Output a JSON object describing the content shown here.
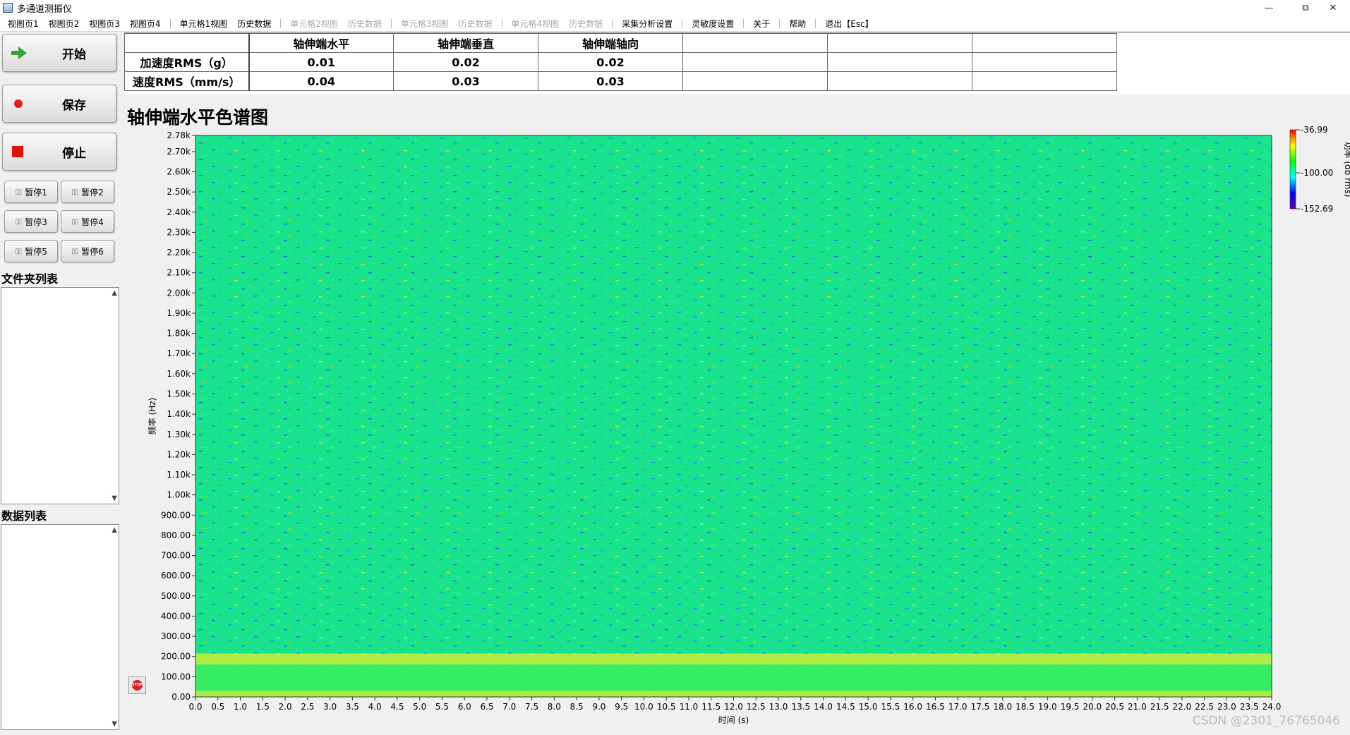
{
  "window": {
    "title": "多通道测振仪",
    "controls": [
      "—",
      "⧉",
      "✕"
    ]
  },
  "menu": [
    {
      "label": "视图页1",
      "enabled": true
    },
    {
      "label": "视图页2",
      "enabled": true
    },
    {
      "label": "视图页3",
      "enabled": true
    },
    {
      "label": "视图页4",
      "enabled": true
    },
    {
      "sep": true
    },
    {
      "label": "单元格1视图",
      "enabled": true
    },
    {
      "label": "历史数据",
      "enabled": true
    },
    {
      "sep": true
    },
    {
      "label": "单元格2视图",
      "enabled": false
    },
    {
      "label": "历史数据",
      "enabled": false
    },
    {
      "sep": true
    },
    {
      "label": "单元格3视图",
      "enabled": false
    },
    {
      "label": "历史数据",
      "enabled": false
    },
    {
      "sep": true
    },
    {
      "label": "单元格4视图",
      "enabled": false
    },
    {
      "label": "历史数据",
      "enabled": false
    },
    {
      "sep": true
    },
    {
      "label": "采集分析设置",
      "enabled": true
    },
    {
      "sep": true
    },
    {
      "label": "灵敏度设置",
      "enabled": true
    },
    {
      "sep": true
    },
    {
      "label": "关于",
      "enabled": true
    },
    {
      "sep": true
    },
    {
      "label": "帮助",
      "enabled": true
    },
    {
      "sep": true
    },
    {
      "label": "退出【Esc】",
      "enabled": true
    }
  ],
  "controls": {
    "start_label": "开始",
    "save_label": "保存",
    "stop_label": "停止",
    "pause_buttons": [
      "暂停1",
      "暂停2",
      "暂停3",
      "暂停4",
      "暂停5",
      "暂停6"
    ]
  },
  "folder_list": {
    "label": "文件夹列表",
    "items": []
  },
  "data_list": {
    "label": "数据列表",
    "items": []
  },
  "rms_table": {
    "headers": [
      "",
      "轴伸端水平",
      "轴伸端垂直",
      "轴伸端轴向",
      "",
      "",
      ""
    ],
    "rows": [
      {
        "label": "加速度RMS（g）",
        "values": [
          "0.01",
          "0.02",
          "0.02",
          "",
          "",
          ""
        ]
      },
      {
        "label": "速度RMS（mm/s）",
        "values": [
          "0.04",
          "0.03",
          "0.03",
          "",
          "",
          ""
        ]
      }
    ]
  },
  "chart_data": {
    "type": "heatmap",
    "title": "轴伸端水平色谱图",
    "xlabel": "时间 (s)",
    "ylabel": "频率 (Hz)",
    "xlim": [
      0,
      24
    ],
    "ylim": [
      0,
      2780
    ],
    "x_ticks": [
      "0.0",
      "0.5",
      "1.0",
      "1.5",
      "2.0",
      "2.5",
      "3.0",
      "3.5",
      "4.0",
      "4.5",
      "5.0",
      "5.5",
      "6.0",
      "6.5",
      "7.0",
      "7.5",
      "8.0",
      "8.5",
      "9.0",
      "9.5",
      "10.0",
      "10.5",
      "11.0",
      "11.5",
      "12.0",
      "12.5",
      "13.0",
      "13.5",
      "14.0",
      "14.5",
      "15.0",
      "15.5",
      "16.0",
      "16.5",
      "17.0",
      "17.5",
      "18.0",
      "18.5",
      "19.0",
      "19.5",
      "20.0",
      "20.5",
      "21.0",
      "21.5",
      "22.0",
      "22.5",
      "23.0",
      "23.5",
      "24.0"
    ],
    "y_ticks": [
      {
        "value": 0,
        "label": "0.00"
      },
      {
        "value": 100,
        "label": "100.00"
      },
      {
        "value": 200,
        "label": "200.00"
      },
      {
        "value": 300,
        "label": "300.00"
      },
      {
        "value": 400,
        "label": "400.00"
      },
      {
        "value": 500,
        "label": "500.00"
      },
      {
        "value": 600,
        "label": "600.00"
      },
      {
        "value": 700,
        "label": "700.00"
      },
      {
        "value": 800,
        "label": "800.00"
      },
      {
        "value": 900,
        "label": "900.00"
      },
      {
        "value": 1000,
        "label": "1.00k"
      },
      {
        "value": 1100,
        "label": "1.10k"
      },
      {
        "value": 1200,
        "label": "1.20k"
      },
      {
        "value": 1300,
        "label": "1.30k"
      },
      {
        "value": 1400,
        "label": "1.40k"
      },
      {
        "value": 1500,
        "label": "1.50k"
      },
      {
        "value": 1600,
        "label": "1.60k"
      },
      {
        "value": 1700,
        "label": "1.70k"
      },
      {
        "value": 1800,
        "label": "1.80k"
      },
      {
        "value": 1900,
        "label": "1.90k"
      },
      {
        "value": 2000,
        "label": "2.00k"
      },
      {
        "value": 2100,
        "label": "2.10k"
      },
      {
        "value": 2200,
        "label": "2.20k"
      },
      {
        "value": 2300,
        "label": "2.30k"
      },
      {
        "value": 2400,
        "label": "2.40k"
      },
      {
        "value": 2500,
        "label": "2.50k"
      },
      {
        "value": 2600,
        "label": "2.60k"
      },
      {
        "value": 2700,
        "label": "2.70k"
      },
      {
        "value": 2780,
        "label": "2.78k"
      }
    ],
    "colorbar": {
      "label": "功率 (db rms)",
      "max": -36.99,
      "mid": -100.0,
      "min": -152.69,
      "max_label": "-36.99",
      "mid_label": "-100.00",
      "min_label": "-152.69",
      "colors": [
        "#ff0000",
        "#ffff00",
        "#00ff00",
        "#00ffff",
        "#0000ff",
        "#6600aa"
      ]
    },
    "background_color": "#19e38c",
    "bands": [
      {
        "freq_low": 160,
        "freq_high": 215,
        "level": "high",
        "color": "#c8f03a"
      },
      {
        "freq_low": 30,
        "freq_high": 160,
        "level": "medium",
        "color": "#3ced5a"
      },
      {
        "freq_low": 0,
        "freq_high": 30,
        "level": "high",
        "color": "#c6ee3a"
      }
    ]
  },
  "stop_icon_label": "STOP",
  "watermark": "CSDN @2301_76765046"
}
